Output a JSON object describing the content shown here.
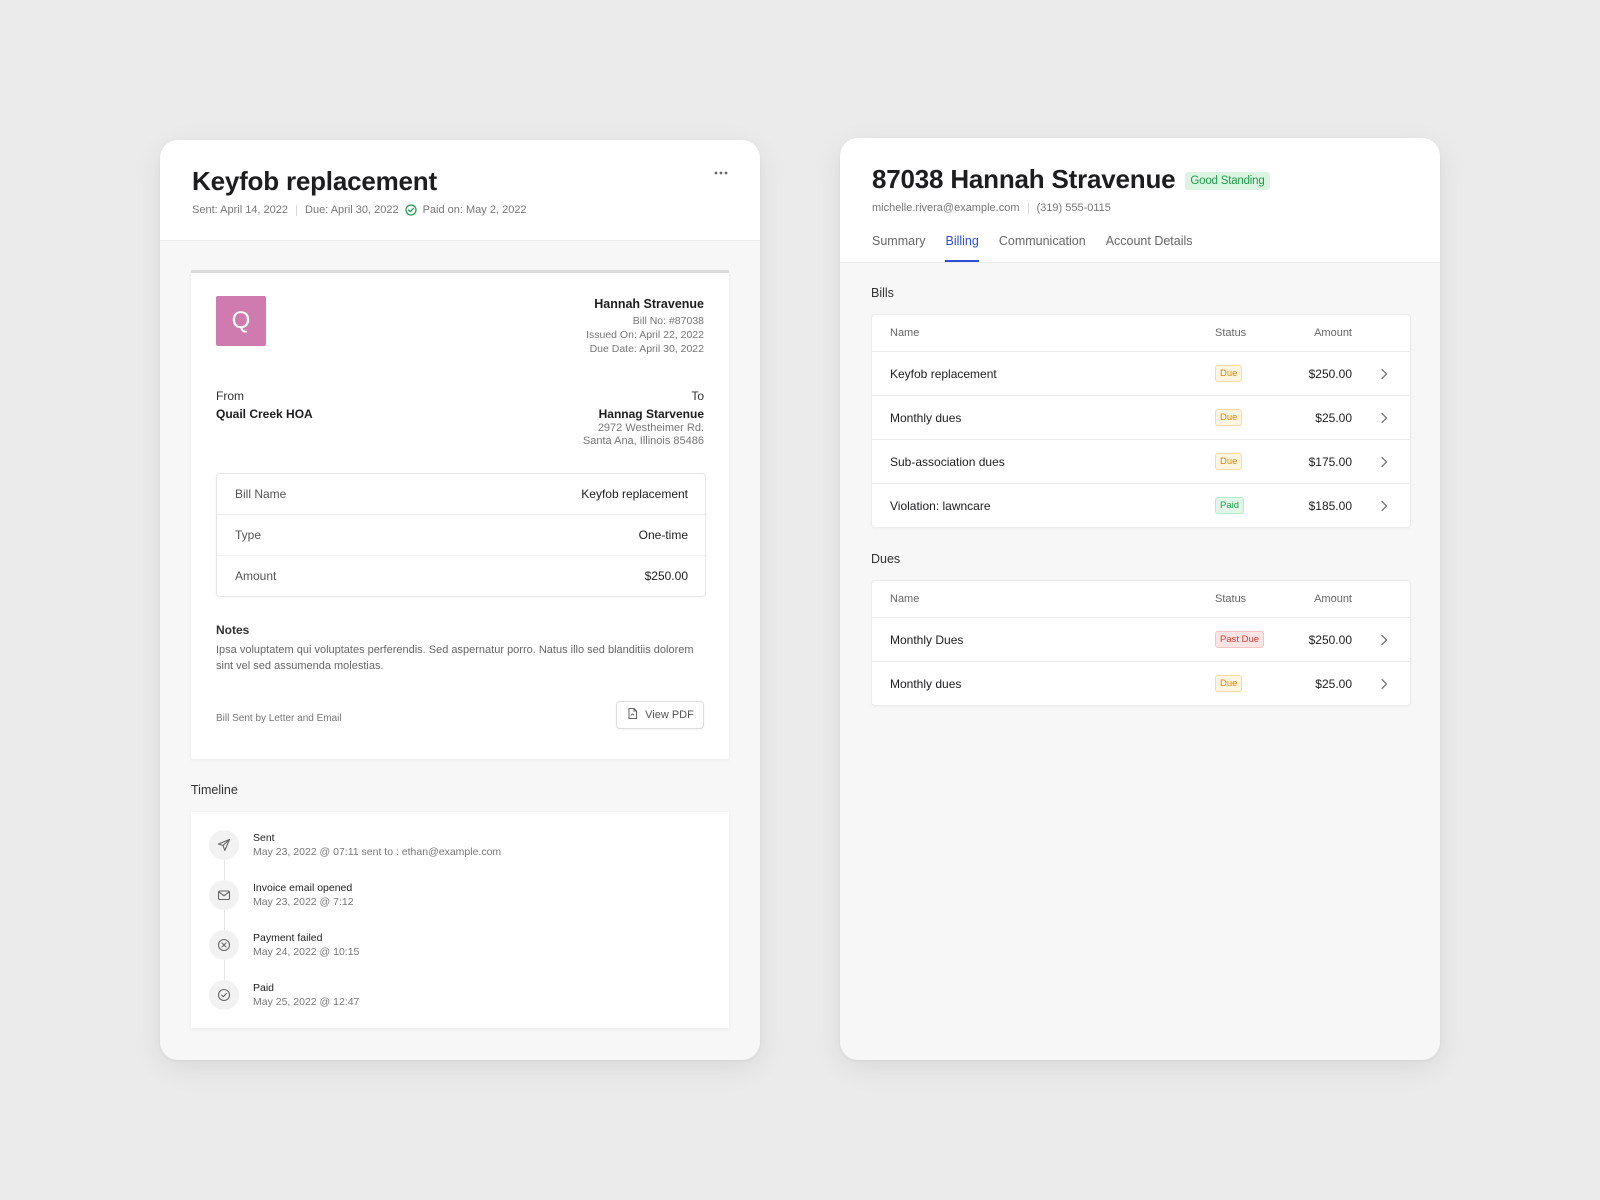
{
  "invoice_card": {
    "title": "Keyfob replacement",
    "sent": "Sent: April 14, 2022",
    "due": "Due: April 30, 2022",
    "paid": "Paid on: May 2, 2022",
    "more_icon": "more-horizontal-icon",
    "invoice": {
      "logo_letter": "Q",
      "logo_color": "#d07bb0",
      "recipient": "Hannah Stravenue",
      "bill_no": "Bill No: #87038",
      "issued_on": "Issued On: April 22, 2022",
      "due_date": "Due Date: April 30, 2022",
      "from_label": "From",
      "from_name": "Quail Creek HOA",
      "to_label": "To",
      "to_name": "Hannag Starvenue",
      "to_address_1": "2972 Westheimer Rd.",
      "to_address_2": "Santa Ana, Illinois 85486",
      "details": [
        {
          "key": "Bill Name",
          "value": "Keyfob replacement"
        },
        {
          "key": "Type",
          "value": "One-time"
        },
        {
          "key": "Amount",
          "value": "$250.00"
        }
      ],
      "notes_title": "Notes",
      "notes_body": "Ipsa voluptatem qui voluptates perferendis. Sed aspernatur porro. Natus illo sed blanditiis dolorem sint vel sed assumenda molestias.",
      "sent_by": "Bill Sent by Letter and Email",
      "view_pdf": "View PDF"
    },
    "timeline_title": "Timeline",
    "timeline": [
      {
        "icon": "send-icon",
        "title": "Sent",
        "sub": "May 23, 2022 @ 07:11 sent to : ethan@example.com"
      },
      {
        "icon": "mail-icon",
        "title": "Invoice email opened",
        "sub": "May 23, 2022 @ 7:12"
      },
      {
        "icon": "x-circle-icon",
        "title": "Payment failed",
        "sub": "May 24, 2022 @ 10:15"
      },
      {
        "icon": "check-circle-icon",
        "title": "Paid",
        "sub": "May 25, 2022 @ 12:47"
      }
    ]
  },
  "account_card": {
    "title": "87038 Hannah Stravenue",
    "standing": "Good Standing",
    "email": "michelle.rivera@example.com",
    "phone": "(319) 555-0115",
    "tabs": [
      "Summary",
      "Billing",
      "Communication",
      "Account Details"
    ],
    "active_tab": "Billing",
    "bills_title": "Bills",
    "dues_title": "Dues",
    "columns": {
      "name": "Name",
      "status": "Status",
      "amount": "Amount"
    },
    "bills": [
      {
        "name": "Keyfob replacement",
        "status": "Due",
        "amount": "$250.00"
      },
      {
        "name": "Monthly dues",
        "status": "Due",
        "amount": "$25.00"
      },
      {
        "name": "Sub-association dues",
        "status": "Due",
        "amount": "$175.00"
      },
      {
        "name": "Violation: lawncare",
        "status": "Paid",
        "amount": "$185.00"
      }
    ],
    "dues": [
      {
        "name": "Monthly Dues",
        "status": "Past Due",
        "amount": "$250.00"
      },
      {
        "name": "Monthly dues",
        "status": "Due",
        "amount": "$25.00"
      }
    ],
    "colors": {
      "accent": "#2e4ed6",
      "due": "#d58a0a",
      "paid": "#22a050",
      "past_due": "#d83b3b"
    }
  }
}
